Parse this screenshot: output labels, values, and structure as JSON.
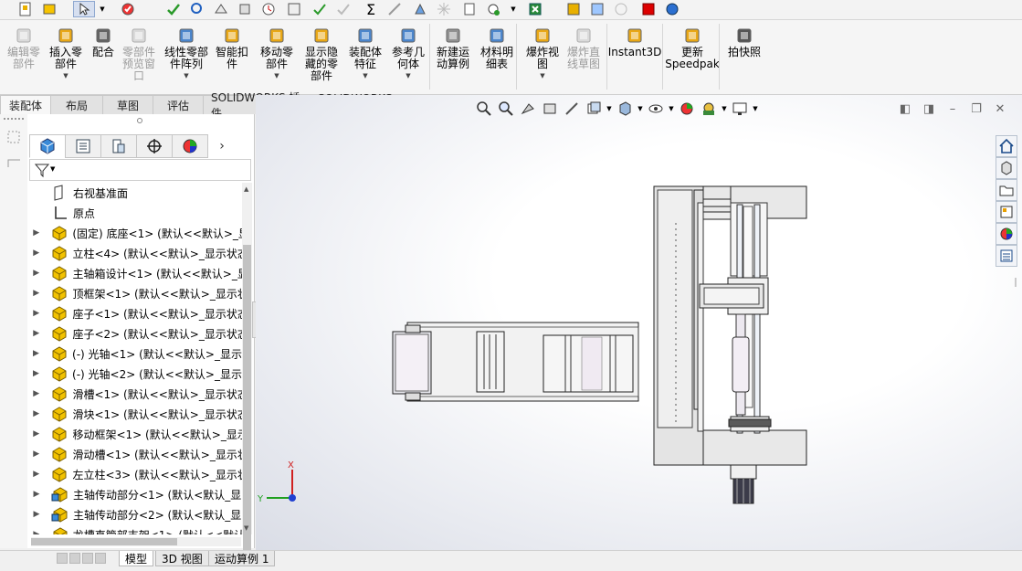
{
  "ribbon": {
    "buttons": [
      {
        "label": "编辑零\n部件",
        "disabled": true,
        "icon": "edit-part-icon"
      },
      {
        "label": "插入零\n部件",
        "disabled": false,
        "icon": "insert-component-icon",
        "caret": true
      },
      {
        "label": "配合",
        "disabled": false,
        "icon": "mate-paperclip-icon"
      },
      {
        "label": "零部件\n预览窗\n口",
        "disabled": true,
        "icon": "component-preview-icon"
      },
      {
        "label": "线性零部\n件阵列",
        "disabled": false,
        "icon": "linear-pattern-icon",
        "caret": true
      },
      {
        "label": "智能扣\n件",
        "disabled": false,
        "icon": "smart-fastener-icon"
      },
      {
        "label": "移动零\n部件",
        "disabled": false,
        "icon": "move-component-icon",
        "caret": true
      },
      {
        "label": "显示隐\n藏的零\n部件",
        "disabled": false,
        "icon": "show-hidden-icon"
      },
      {
        "label": "装配体\n特征",
        "disabled": false,
        "icon": "assembly-feature-icon",
        "caret": true
      },
      {
        "label": "参考几\n何体",
        "disabled": false,
        "icon": "reference-geometry-icon",
        "caret": true
      },
      {
        "label": "新建运\n动算例",
        "disabled": false,
        "icon": "motion-study-icon"
      },
      {
        "label": "材料明\n细表",
        "disabled": false,
        "icon": "bom-icon"
      },
      {
        "label": "爆炸视\n图",
        "disabled": false,
        "icon": "exploded-view-icon",
        "caret": true
      },
      {
        "label": "爆炸直\n线草图",
        "disabled": true,
        "icon": "explode-line-sketch-icon"
      },
      {
        "label": "Instant3D",
        "disabled": false,
        "icon": "instant3d-icon"
      },
      {
        "label": "更新\nSpeedpak",
        "disabled": false,
        "icon": "speedpak-icon"
      },
      {
        "label": "拍快照",
        "disabled": false,
        "icon": "camera-icon"
      }
    ]
  },
  "tabs": [
    "装配体",
    "布局",
    "草图",
    "评估",
    "SOLIDWORKS 插件",
    "SOLIDWORKS MBD"
  ],
  "tree": [
    {
      "label": "右视基准面",
      "icon": "plane-icon",
      "arrow": false
    },
    {
      "label": "原点",
      "icon": "origin-icon",
      "arrow": false
    },
    {
      "label": "(固定) 底座<1> (默认<<默认>_显",
      "icon": "part-icon",
      "arrow": true
    },
    {
      "label": "立柱<4> (默认<<默认>_显示状态",
      "icon": "part-icon",
      "arrow": true
    },
    {
      "label": "主轴箱设计<1> (默认<<默认>_显",
      "icon": "part-icon",
      "arrow": true
    },
    {
      "label": "顶框架<1> (默认<<默认>_显示状",
      "icon": "part-icon",
      "arrow": true
    },
    {
      "label": "座子<1> (默认<<默认>_显示状态",
      "icon": "part-icon",
      "arrow": true
    },
    {
      "label": "座子<2> (默认<<默认>_显示状态",
      "icon": "part-icon",
      "arrow": true
    },
    {
      "label": "(-) 光轴<1> (默认<<默认>_显示状",
      "icon": "part-icon",
      "arrow": true
    },
    {
      "label": "(-) 光轴<2> (默认<<默认>_显示状",
      "icon": "part-icon",
      "arrow": true
    },
    {
      "label": "滑槽<1> (默认<<默认>_显示状态",
      "icon": "part-icon",
      "arrow": true
    },
    {
      "label": "滑块<1> (默认<<默认>_显示状态",
      "icon": "part-icon",
      "arrow": true
    },
    {
      "label": "移动框架<1> (默认<<默认>_显示",
      "icon": "part-icon",
      "arrow": true
    },
    {
      "label": "滑动槽<1> (默认<<默认>_显示状",
      "icon": "part-icon",
      "arrow": true
    },
    {
      "label": "左立柱<3> (默认<<默认>_显示状",
      "icon": "part-icon",
      "arrow": true
    },
    {
      "label": "主轴传动部分<1> (默认<默认_显",
      "icon": "subassembly-icon",
      "arrow": true
    },
    {
      "label": "主轴传动部分<2> (默认<默认_显",
      "icon": "subassembly-icon",
      "arrow": true
    },
    {
      "label": "龙槽直管部支架<1> (默认<<默认",
      "icon": "part-icon",
      "arrow": true
    }
  ],
  "triad": {
    "y_label": "Y",
    "x_label": "X"
  },
  "bottom_tabs": [
    "模型",
    "3D 视图",
    "运动算例 1"
  ]
}
